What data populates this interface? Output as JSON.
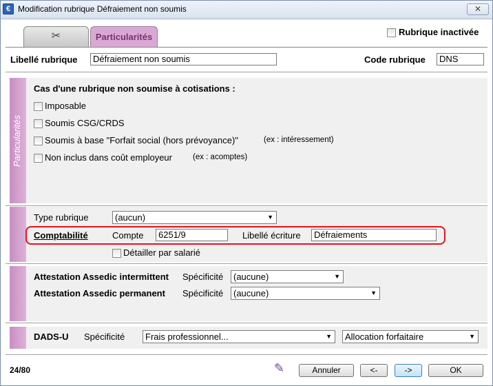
{
  "window": {
    "title": "Modification rubrique Défraiement non soumis",
    "close_label": "✕"
  },
  "tabs": [
    {
      "label": ""
    },
    {
      "label": "Particularités"
    }
  ],
  "inactive": {
    "label": "Rubrique inactivée",
    "checked": false
  },
  "header": {
    "libelle_label": "Libellé rubrique",
    "libelle_value": "Défraiement non soumis",
    "code_label": "Code rubrique",
    "code_value": "DNS"
  },
  "particularites": {
    "side_label": "Particularités",
    "heading": "Cas d'une rubrique non soumise à cotisations :",
    "options": [
      {
        "label": "Imposable",
        "note": ""
      },
      {
        "label": "Soumis CSG/CRDS",
        "note": ""
      },
      {
        "label": "Soumis à base \"Forfait social (hors prévoyance)\"",
        "note": "(ex : intéressement)"
      },
      {
        "label": "Non inclus dans coût employeur",
        "note": "(ex : acomptes)"
      }
    ]
  },
  "compta": {
    "type_label": "Type rubrique",
    "type_value": "(aucun)",
    "comptabilite_label": "Comptabilité",
    "compte_label": "Compte",
    "compte_value": "6251/9",
    "libelle_ecriture_label": "Libellé écriture",
    "libelle_ecriture_value": "Défraiements",
    "detail_label": "Détailler par salarié"
  },
  "assedic": {
    "intermittent_label": "Attestation Assedic intermittent",
    "intermittent_spec_label": "Spécificité",
    "intermittent_value": "(aucune)",
    "permanent_label": "Attestation Assedic permanent",
    "permanent_spec_label": "Spécificité",
    "permanent_value": "(aucune)"
  },
  "dads": {
    "label": "DADS-U",
    "spec_label": "Spécificité",
    "value1": "Frais professionnel...",
    "value2": "Allocation forfaitaire"
  },
  "footer": {
    "counter": "24/80",
    "annuler": "Annuler",
    "prev": "<-",
    "next": "->",
    "ok": "OK"
  },
  "colors": {
    "accent_tab": "#d9a9d4",
    "side_bar": "#c98dc4",
    "highlight_box": "#e3131a"
  }
}
